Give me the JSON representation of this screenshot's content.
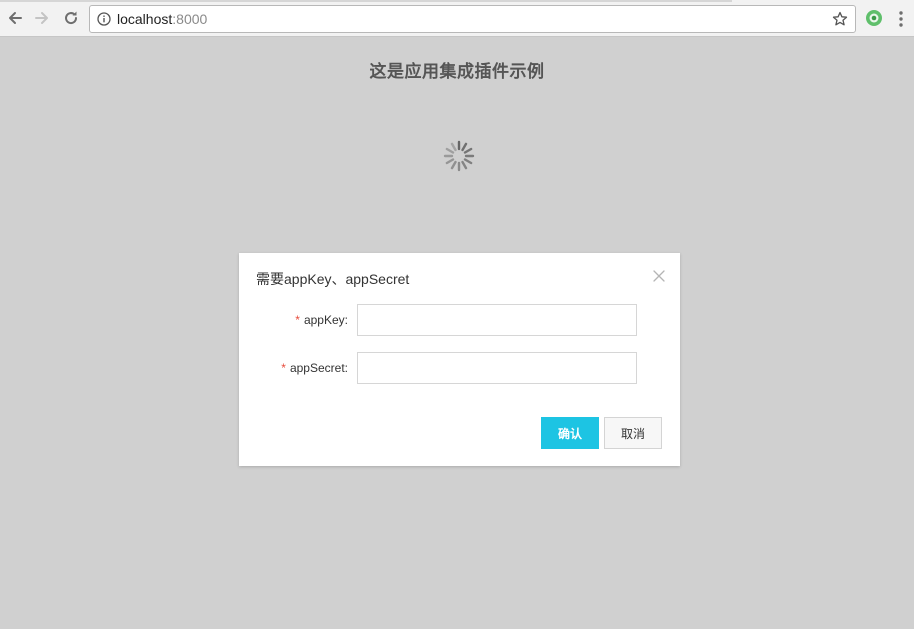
{
  "browser": {
    "url_host": "localhost",
    "url_port": ":8000",
    "icons": {
      "back": "arrow-left-icon",
      "forward": "arrow-right-icon",
      "reload": "reload-icon",
      "info": "info-icon",
      "bookmark": "star-icon",
      "extension": "extension-icon",
      "menu": "more-vertical-icon"
    }
  },
  "page": {
    "title": "这是应用集成插件示例",
    "loading_icon": "spinner-icon"
  },
  "modal": {
    "title": "需要appKey、appSecret",
    "close_icon": "close-icon",
    "fields": [
      {
        "required_mark": "*",
        "label": "appKey:",
        "value": "",
        "placeholder": ""
      },
      {
        "required_mark": "*",
        "label": "appSecret:",
        "value": "",
        "placeholder": ""
      }
    ],
    "confirm_label": "确认",
    "cancel_label": "取消"
  },
  "colors": {
    "backdrop": "#d0d0d0",
    "primary_button": "#1dc4e3",
    "required_mark": "#e74c3c"
  }
}
